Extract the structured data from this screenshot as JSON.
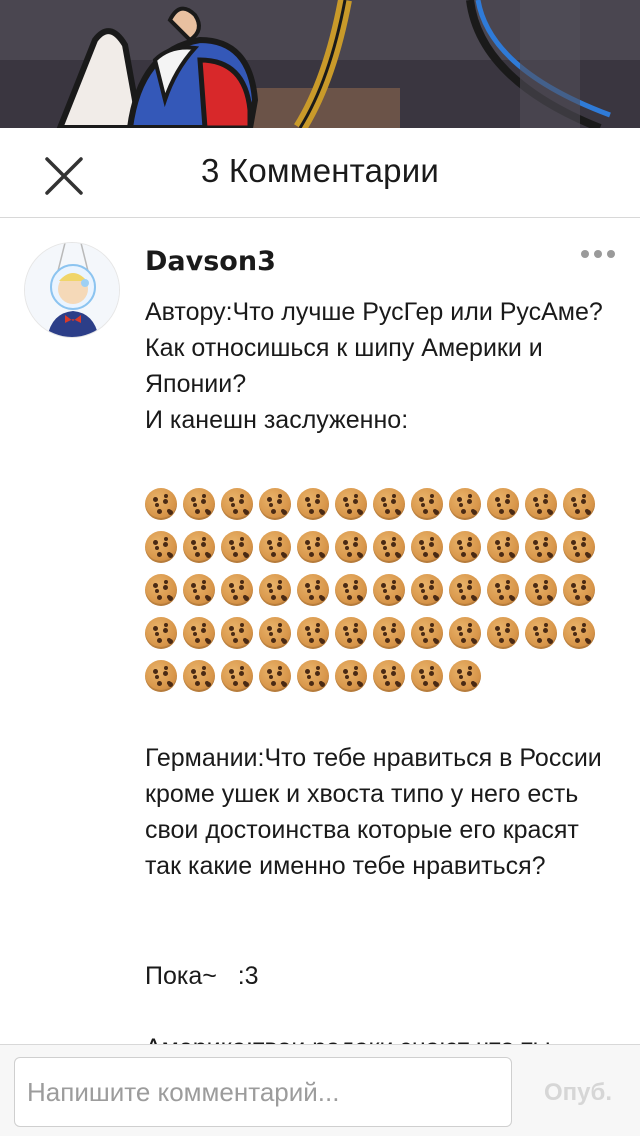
{
  "header": {
    "title": "3 Комментарии"
  },
  "comment": {
    "username": "Davson3",
    "text_part1": "Автору:Что лучше РусГер или РусАме?\nКак относишься к шипу Америки и Японии?\nИ канешн заслуженно:",
    "cookie_count": 57,
    "text_part2": "Германии:Что тебе нравиться в России кроме ушек и хвоста типо у него есть свои достоинства которые его красят так какие именно тебе нравиться?",
    "text_part3": "Пока~   :3",
    "text_part4_partial": "Америка:твои радаки знают что ты"
  },
  "footer": {
    "input_placeholder": "Напишите комментарий...",
    "publish_label": "Опуб."
  },
  "icons": {
    "close": "close-icon",
    "more": "more-icon",
    "cookie": "cookie-emoji"
  }
}
